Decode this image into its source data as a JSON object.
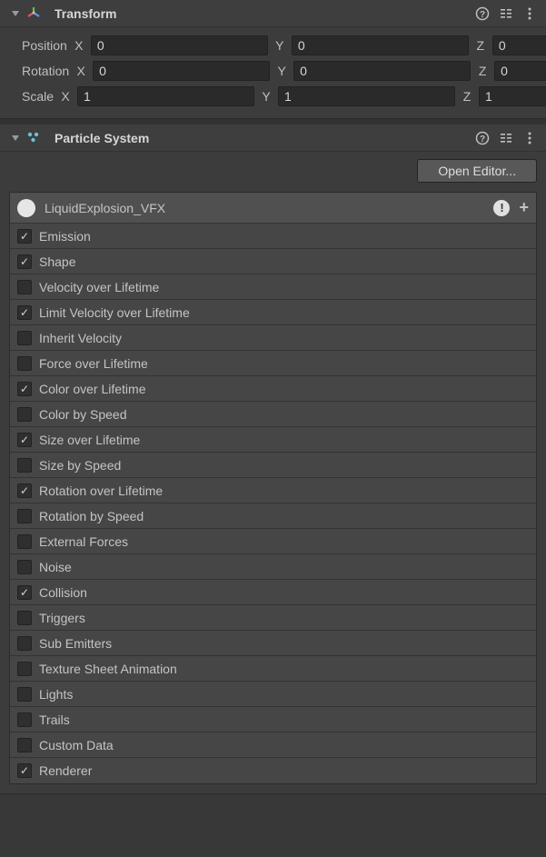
{
  "transform": {
    "title": "Transform",
    "position": {
      "label": "Position",
      "x": "0",
      "y": "0",
      "z": "0"
    },
    "rotation": {
      "label": "Rotation",
      "x": "0",
      "y": "0",
      "z": "0"
    },
    "scale": {
      "label": "Scale",
      "x": "1",
      "y": "1",
      "z": "1"
    },
    "axis": {
      "x": "X",
      "y": "Y",
      "z": "Z"
    }
  },
  "particleSystem": {
    "title": "Particle System",
    "openEditor": "Open Editor...",
    "mainModule": "LiquidExplosion_VFX",
    "modules": [
      {
        "label": "Emission",
        "checked": true
      },
      {
        "label": "Shape",
        "checked": true
      },
      {
        "label": "Velocity over Lifetime",
        "checked": false
      },
      {
        "label": "Limit Velocity over Lifetime",
        "checked": true
      },
      {
        "label": "Inherit Velocity",
        "checked": false
      },
      {
        "label": "Force over Lifetime",
        "checked": false
      },
      {
        "label": "Color over Lifetime",
        "checked": true
      },
      {
        "label": "Color by Speed",
        "checked": false
      },
      {
        "label": "Size over Lifetime",
        "checked": true
      },
      {
        "label": "Size by Speed",
        "checked": false
      },
      {
        "label": "Rotation over Lifetime",
        "checked": true
      },
      {
        "label": "Rotation by Speed",
        "checked": false
      },
      {
        "label": "External Forces",
        "checked": false
      },
      {
        "label": "Noise",
        "checked": false
      },
      {
        "label": "Collision",
        "checked": true
      },
      {
        "label": "Triggers",
        "checked": false
      },
      {
        "label": "Sub Emitters",
        "checked": false
      },
      {
        "label": "Texture Sheet Animation",
        "checked": false
      },
      {
        "label": "Lights",
        "checked": false
      },
      {
        "label": "Trails",
        "checked": false
      },
      {
        "label": "Custom Data",
        "checked": false
      },
      {
        "label": "Renderer",
        "checked": true
      }
    ]
  }
}
